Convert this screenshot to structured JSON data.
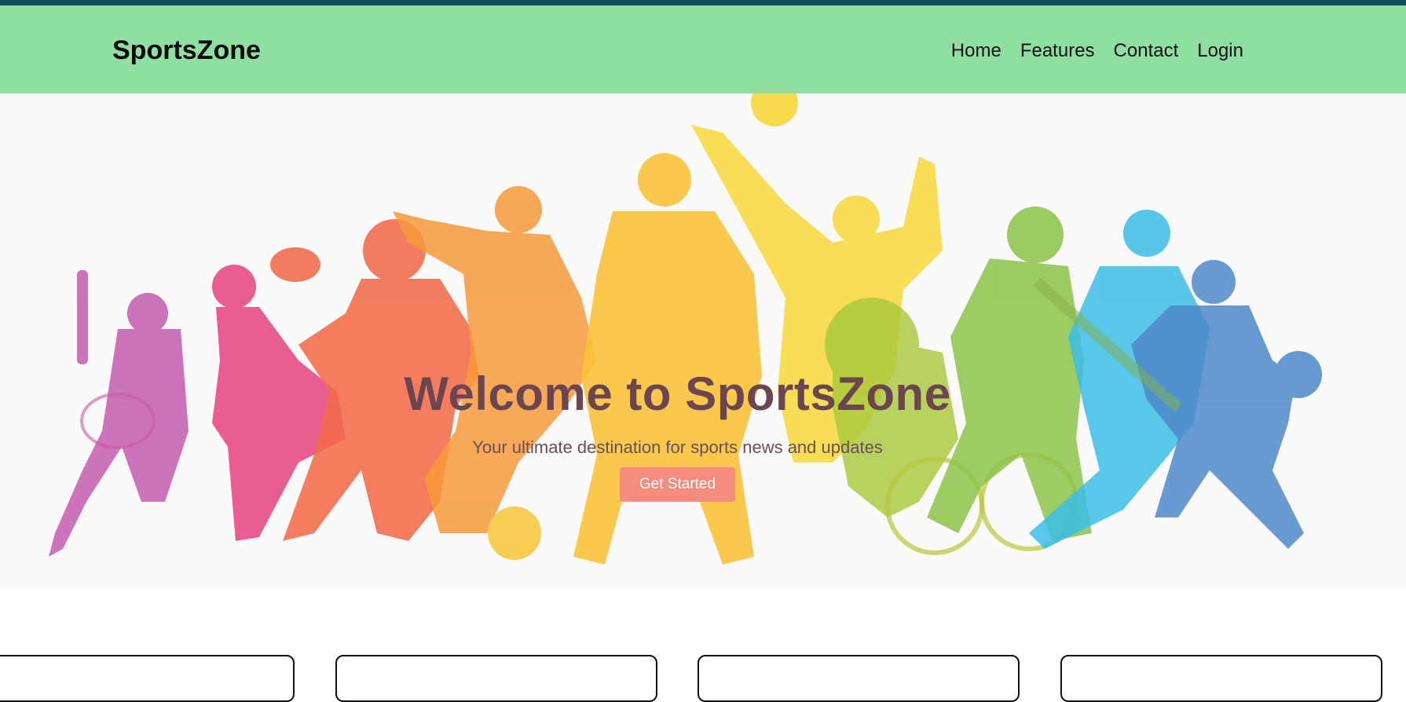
{
  "header": {
    "brand": "SportsZone",
    "nav": [
      "Home",
      "Features",
      "Contact",
      "Login"
    ]
  },
  "hero": {
    "title": "Welcome to SportsZone",
    "subtitle": "Your ultimate destination for sports news and updates",
    "cta_label": "Get Started"
  },
  "colors": {
    "topbar": "#0f4d5e",
    "header_bg": "#8fdfa2",
    "cta_bg": "#f58c80",
    "title_text": "#6b4650"
  },
  "image": {
    "alt": "sports-silhouettes-illustration"
  }
}
